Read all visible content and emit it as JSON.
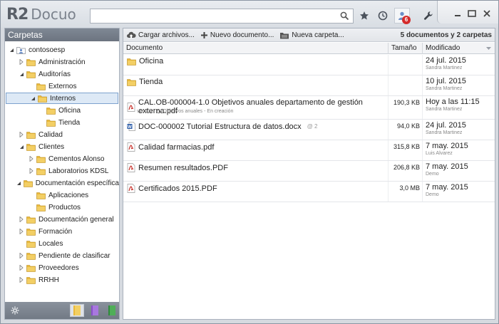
{
  "app": {
    "logo_r2": "R2",
    "logo_name": "Docuo",
    "search_value": "",
    "notifications_count": "6"
  },
  "sidebar": {
    "title": "Carpetas",
    "tree": [
      {
        "label": "contosoesp",
        "level": 0,
        "toggle": "expanded",
        "icon": "user-folder-icon"
      },
      {
        "label": "Administración",
        "level": 1,
        "toggle": "collapsed",
        "icon": "folder-icon"
      },
      {
        "label": "Auditorías",
        "level": 1,
        "toggle": "expanded",
        "icon": "folder-icon"
      },
      {
        "label": "Externos",
        "level": 2,
        "toggle": "none",
        "icon": "folder-icon"
      },
      {
        "label": "Internos",
        "level": 2,
        "toggle": "expanded",
        "icon": "folder-icon",
        "selected": true
      },
      {
        "label": "Oficina",
        "level": 3,
        "toggle": "none",
        "icon": "folder-icon"
      },
      {
        "label": "Tienda",
        "level": 3,
        "toggle": "none",
        "icon": "folder-icon"
      },
      {
        "label": "Calidad",
        "level": 1,
        "toggle": "collapsed",
        "icon": "folder-icon"
      },
      {
        "label": "Clientes",
        "level": 1,
        "toggle": "expanded",
        "icon": "folder-icon"
      },
      {
        "label": "Cementos Alonso",
        "level": 2,
        "toggle": "collapsed",
        "icon": "folder-icon"
      },
      {
        "label": "Laboratorios KDSL",
        "level": 2,
        "toggle": "collapsed",
        "icon": "folder-icon"
      },
      {
        "label": "Documentación específica",
        "level": 1,
        "toggle": "expanded",
        "icon": "folder-icon"
      },
      {
        "label": "Aplicaciones",
        "level": 2,
        "toggle": "none",
        "icon": "folder-icon"
      },
      {
        "label": "Productos",
        "level": 2,
        "toggle": "none",
        "icon": "folder-icon"
      },
      {
        "label": "Documentación general",
        "level": 1,
        "toggle": "collapsed",
        "icon": "folder-icon"
      },
      {
        "label": "Formación",
        "level": 1,
        "toggle": "collapsed",
        "icon": "folder-icon"
      },
      {
        "label": "Locales",
        "level": 1,
        "toggle": "none",
        "icon": "folder-icon"
      },
      {
        "label": "Pendiente de clasificar",
        "level": 1,
        "toggle": "collapsed",
        "icon": "folder-icon"
      },
      {
        "label": "Proveedores",
        "level": 1,
        "toggle": "collapsed",
        "icon": "folder-icon"
      },
      {
        "label": "RRHH",
        "level": 1,
        "toggle": "collapsed",
        "icon": "folder-icon"
      }
    ]
  },
  "toolbar": {
    "upload_label": "Cargar archivos...",
    "new_doc_label": "Nuevo documento...",
    "new_folder_label": "Nueva carpeta...",
    "summary": "5 documentos y 2 carpetas"
  },
  "table": {
    "headers": {
      "name": "Documento",
      "size": "Tamaño",
      "modified": "Modificado"
    },
    "rows": [
      {
        "type": "folder",
        "name": "Oficina",
        "size": "",
        "date": "24 jul. 2015",
        "user": "Sandra Martinez",
        "sub": ""
      },
      {
        "type": "folder",
        "name": "Tienda",
        "size": "",
        "date": "10 jul. 2015",
        "user": "Sandra Martinez",
        "sub": ""
      },
      {
        "type": "pdf",
        "name": "CAL.OB-000004-1.0 Objetivos anuales departamento de gestión externa.pdf",
        "size": "190,3 KB",
        "date": "Hoy a las 11:15",
        "user": "Sandra Martinez",
        "sub_version": "ver 1.0",
        "sub_workflow": "Objetivos anuales",
        "sub_state": "En creación"
      },
      {
        "type": "word",
        "name": "DOC-000002 Tutorial Estructura de datos.docx",
        "size": "94,0 KB",
        "date": "24 jul. 2015",
        "user": "Sandra Martinez",
        "mentions": "2"
      },
      {
        "type": "pdf",
        "name": "Calidad farmacias.pdf",
        "size": "315,8 KB",
        "date": "7 may. 2015",
        "user": "Luis Alvarez"
      },
      {
        "type": "pdf",
        "name": "Resumen resultados.PDF",
        "size": "206,8 KB",
        "date": "7 may. 2015",
        "user": "Demo"
      },
      {
        "type": "pdf",
        "name": "Certificados 2015.PDF",
        "size": "3,0 MB",
        "date": "7 may. 2015",
        "user": "Demo"
      }
    ]
  },
  "colors": {
    "folder": "#e9b93a",
    "pdf": "#c8302a",
    "word": "#2b5ca8",
    "notification": "#d52b2b",
    "selection": "#dde9f6"
  }
}
